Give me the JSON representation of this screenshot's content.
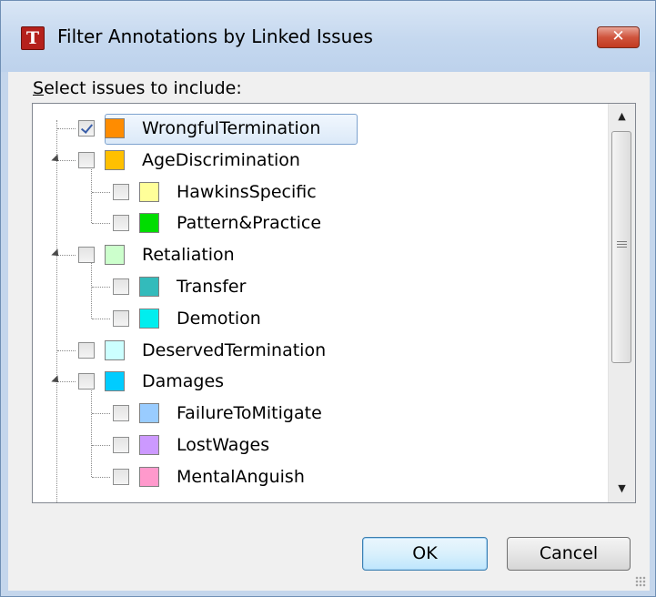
{
  "window": {
    "title": "Filter Annotations by Linked Issues",
    "app_icon_glyph": "T",
    "close_glyph": "✕"
  },
  "prompt": {
    "mnemonic": "S",
    "rest": "elect issues to include:"
  },
  "tree": {
    "items": [
      {
        "label": "WrongfulTermination",
        "color": "#ff8c00",
        "checked": true,
        "level": 0,
        "expandable": false
      },
      {
        "label": "AgeDiscrimination",
        "color": "#ffc000",
        "checked": false,
        "level": 0,
        "expandable": true
      },
      {
        "label": "HawkinsSpecific",
        "color": "#ffff99",
        "checked": false,
        "level": 1,
        "expandable": false
      },
      {
        "label": "Pattern&Practice",
        "color": "#00dd00",
        "checked": false,
        "level": 1,
        "expandable": false
      },
      {
        "label": "Retaliation",
        "color": "#ccffcc",
        "checked": false,
        "level": 0,
        "expandable": true
      },
      {
        "label": "Transfer",
        "color": "#33bbbb",
        "checked": false,
        "level": 1,
        "expandable": false
      },
      {
        "label": "Demotion",
        "color": "#00eeee",
        "checked": false,
        "level": 1,
        "expandable": false
      },
      {
        "label": "DeservedTermination",
        "color": "#ccffff",
        "checked": false,
        "level": 0,
        "expandable": false
      },
      {
        "label": "Damages",
        "color": "#00ccff",
        "checked": false,
        "level": 0,
        "expandable": true
      },
      {
        "label": "FailureToMitigate",
        "color": "#99ccff",
        "checked": false,
        "level": 1,
        "expandable": false
      },
      {
        "label": "LostWages",
        "color": "#cc99ff",
        "checked": false,
        "level": 1,
        "expandable": false
      },
      {
        "label": "MentalAnguish",
        "color": "#ff99cc",
        "checked": false,
        "level": 1,
        "expandable": false
      }
    ]
  },
  "scrollbar": {
    "up_glyph": "▲",
    "down_glyph": "▼"
  },
  "buttons": {
    "ok": "OK",
    "cancel": "Cancel"
  }
}
